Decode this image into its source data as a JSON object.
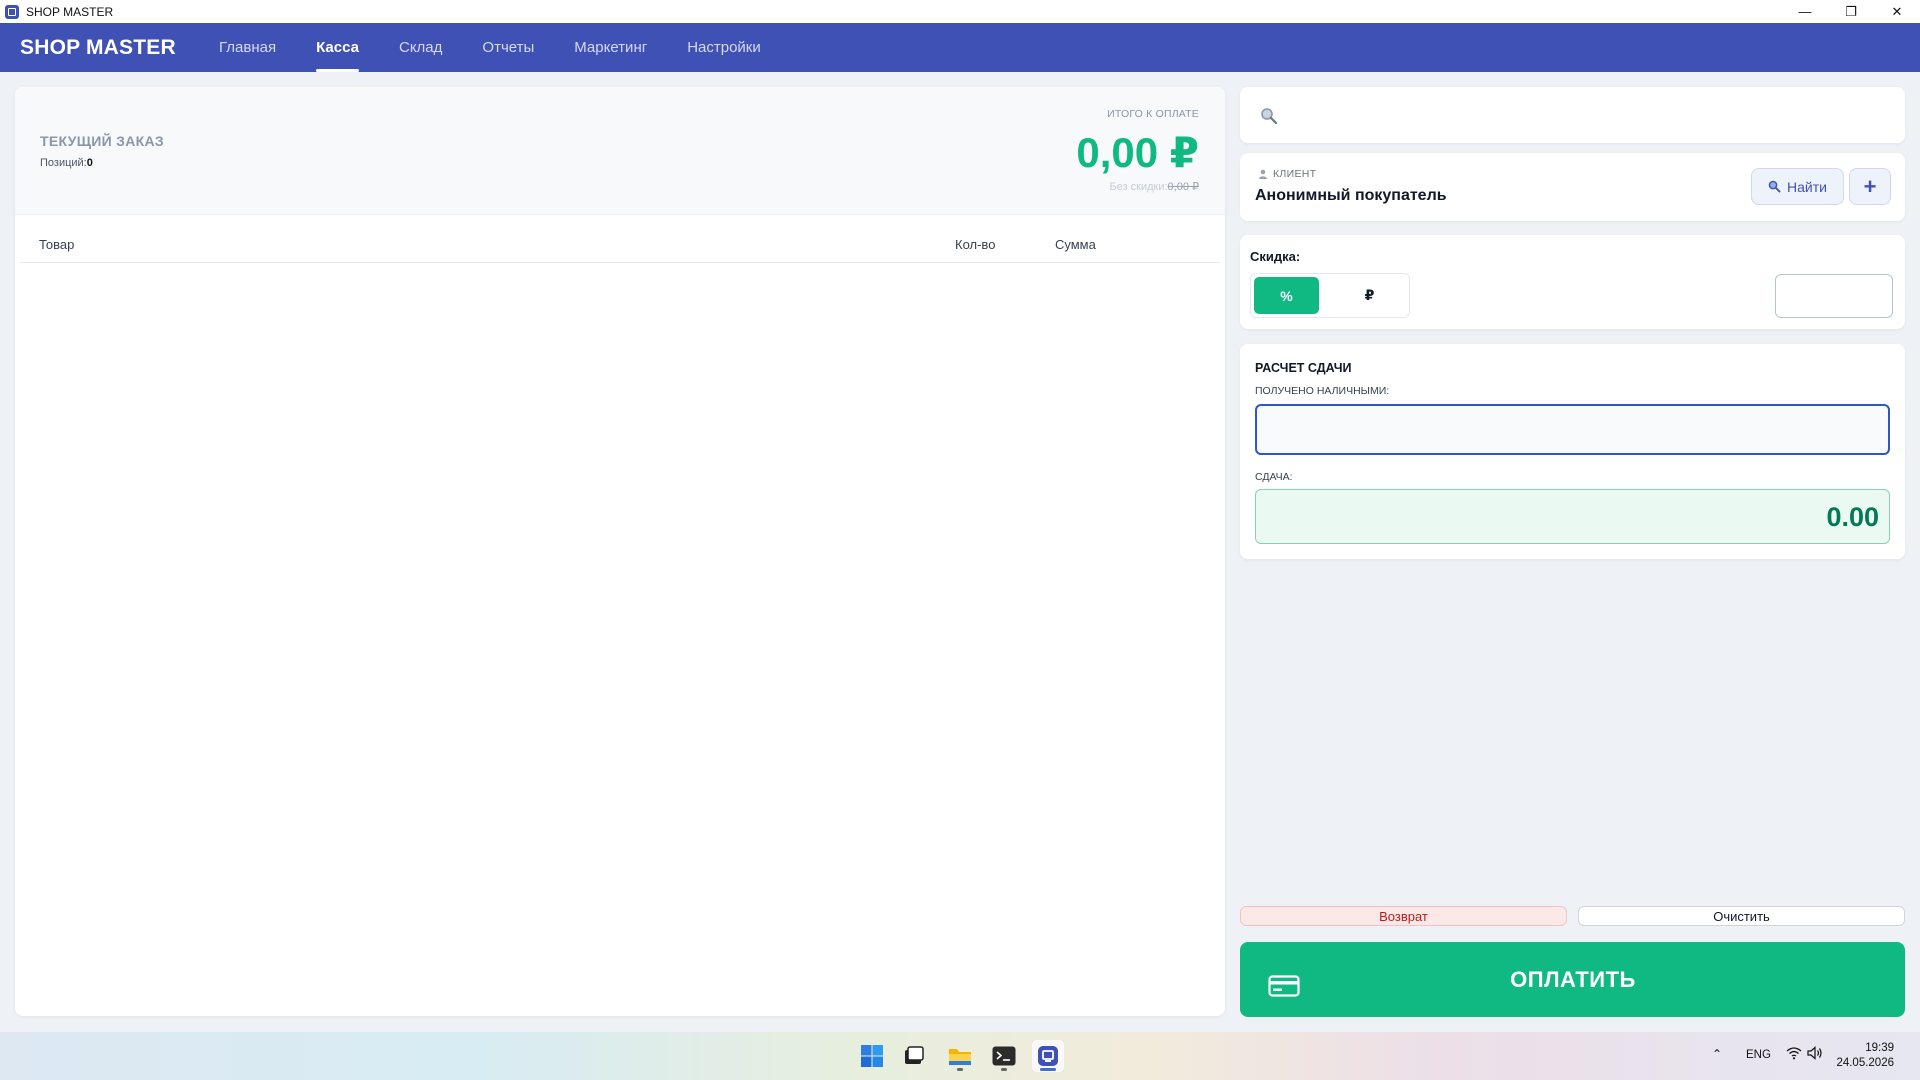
{
  "window": {
    "title": "SHOP MASTER"
  },
  "nav": {
    "brand": "SHOP MASTER",
    "items": [
      {
        "label": "Главная",
        "active": false
      },
      {
        "label": "Касса",
        "active": true
      },
      {
        "label": "Склад",
        "active": false
      },
      {
        "label": "Отчеты",
        "active": false
      },
      {
        "label": "Маркетинг",
        "active": false
      },
      {
        "label": "Настройки",
        "active": false
      }
    ]
  },
  "order": {
    "title": "ТЕКУЩИЙ ЗАКАЗ",
    "positions_label": "Позиций:",
    "positions_count": "0",
    "total_label": "ИТОГО К ОПЛАТЕ",
    "total_value": "0,00 ₽",
    "no_discount_label": "Без скидки:",
    "no_discount_value": "0,00 ₽",
    "columns": [
      "Товар",
      "Кол-во",
      "Сумма"
    ]
  },
  "search": {
    "icon": "search-icon",
    "value": "",
    "placeholder": ""
  },
  "client": {
    "label": "КЛИЕНТ",
    "name": "Анонимный покупатель",
    "find_label": "Найти",
    "add_label": "+"
  },
  "discount": {
    "label": "Скидка:",
    "pct_label": "%",
    "rub_label": "₽",
    "selected": "%",
    "value": ""
  },
  "change": {
    "title": "РАСЧЕТ СДАЧИ",
    "cash_label": "ПОЛУЧЕНО НАЛИЧНЫМИ:",
    "cash_value": "",
    "change_label": "СДАЧА:",
    "change_value": "0.00"
  },
  "actions": {
    "return_label": "Возврат",
    "clear_label": "Очистить",
    "pay_label": "ОПЛАТИТЬ"
  },
  "taskbar": {
    "lang": "ENG",
    "time": "19:39",
    "date": "24.05.2026"
  },
  "colors": {
    "brand": "#3f51b5",
    "accent_green": "#10b981",
    "return_red": "#b91c1c"
  }
}
